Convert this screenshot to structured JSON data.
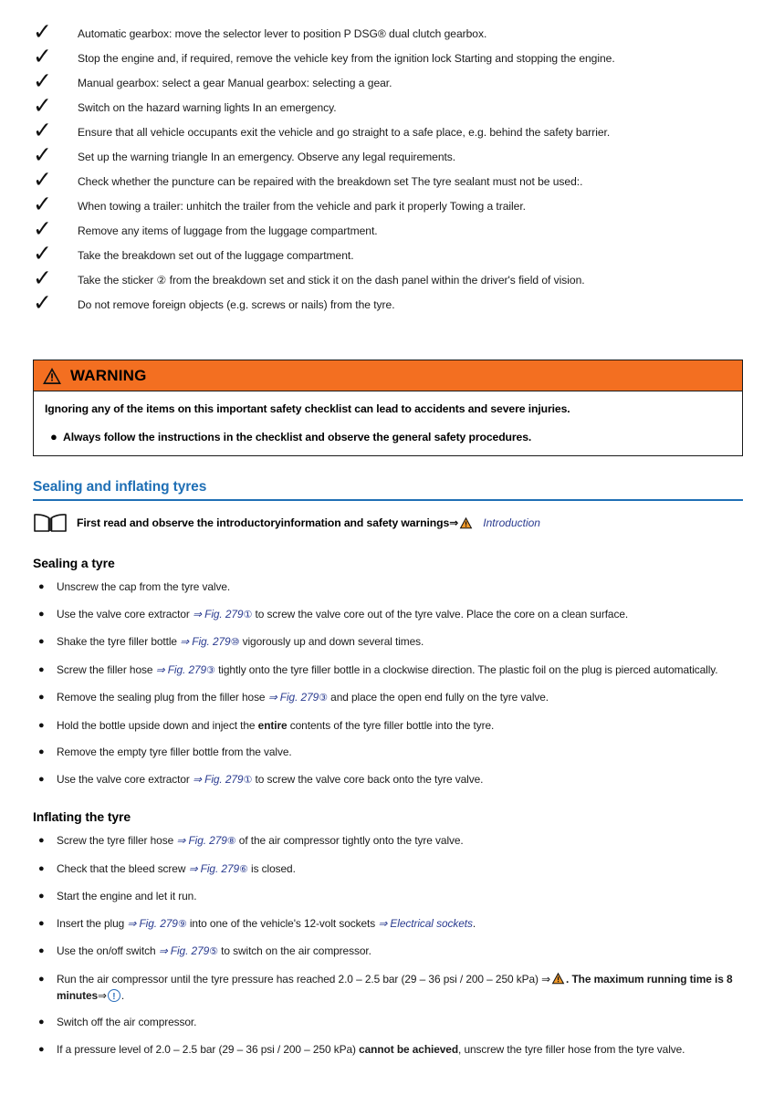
{
  "checklist": {
    "icon": "check-mark-icon",
    "items": [
      "Automatic gearbox: move the selector lever to position P DSG® dual clutch gearbox.",
      "Stop the engine and, if required, remove the vehicle key from the ignition lock Starting and stopping the engine.",
      "Manual gearbox: select a gear Manual gearbox: selecting a gear.",
      "Switch on the hazard warning lights In an emergency.",
      "Ensure that all vehicle occupants exit the vehicle and go straight to a safe place, e.g. behind the safety barrier.",
      "Set up the warning triangle In an emergency. Observe any legal requirements.",
      "Check whether the puncture can be repaired with the breakdown set The tyre sealant must not be used:.",
      "When towing a trailer: unhitch the trailer from the vehicle and park it properly Towing a trailer.",
      "Remove any items of luggage from the luggage compartment.",
      "Take the breakdown set out of the luggage compartment.",
      "Take the sticker ② from the breakdown set and stick it on the dash panel within the driver's field of vision.",
      "Do not remove foreign objects (e.g. screws or nails) from the tyre."
    ]
  },
  "warning": {
    "icon": "warning-triangle-icon",
    "title": "WARNING",
    "header_color": "#F36F21",
    "lead": "Ignoring any of the items on this important safety checklist can lead to accidents and severe injuries.",
    "bullet_marker": "●",
    "bullets": [
      "Always follow the instructions in the checklist and observe the general safety procedures."
    ]
  },
  "section": {
    "title": "Sealing and inflating tyres",
    "accent_color": "#1F6FB5"
  },
  "intro_note": {
    "icon": "open-book-icon",
    "text": "First read and observe the introductoryinformation and safety warnings",
    "arrow": "⇒",
    "warning_icon": "warning-triangle-icon",
    "link": "Introduction"
  },
  "sealing": {
    "heading": "Sealing a tyre",
    "bullet_marker": "●",
    "items": [
      {
        "pre": "Unscrew the cap from the tyre valve.",
        "ref": "",
        "circle": "",
        "post": ""
      },
      {
        "pre": "Use the valve core extractor ",
        "ref": "⇒ Fig. 279",
        "circle": "①",
        "post": " to screw the valve core out of the tyre valve. Place the core on a clean surface."
      },
      {
        "pre": "Shake the tyre filler bottle ",
        "ref": "⇒ Fig. 279",
        "circle": "⑩",
        "post": " vigorously up and down several times."
      },
      {
        "pre": "Screw the filler hose ",
        "ref": "⇒ Fig. 279",
        "circle": "③",
        "post": " tightly onto the tyre filler bottle in a clockwise direction. The plastic foil on the plug is pierced automatically."
      },
      {
        "pre": "Remove the sealing plug from the filler hose ",
        "ref": "⇒ Fig. 279",
        "circle": "③",
        "post": " and place the open end fully on the tyre valve."
      },
      {
        "pre": "Hold the bottle upside down and inject the ",
        "bold": "entire",
        "post": " contents of the tyre filler bottle into the tyre."
      },
      {
        "pre": "Remove the empty tyre filler bottle from the valve.",
        "ref": "",
        "circle": "",
        "post": ""
      },
      {
        "pre": "Use the valve core extractor ",
        "ref": "⇒ Fig. 279",
        "circle": "①",
        "post": " to screw the valve core back onto the tyre valve."
      }
    ]
  },
  "inflating": {
    "heading": "Inflating the tyre",
    "bullet_marker": "●",
    "items": [
      {
        "pre": "Screw the tyre filler hose ",
        "ref": "⇒ Fig. 279",
        "circle": "⑧",
        "post": " of the air compressor tightly onto the tyre valve."
      },
      {
        "pre": "Check that the bleed screw ",
        "ref": "⇒ Fig. 279",
        "circle": "⑥",
        "post": " is closed."
      },
      {
        "pre": "Start the engine and let it run.",
        "ref": "",
        "circle": "",
        "post": ""
      },
      {
        "pre": "Insert the plug ",
        "ref": "⇒ Fig. 279",
        "circle": "⑨",
        "post": " into one of the vehicle's 12-volt sockets ",
        "link": "⇒ Electrical sockets",
        "tail": "."
      },
      {
        "pre": "Use the on/off switch ",
        "ref": "⇒ Fig. 279",
        "circle": "⑤",
        "post": " to switch on the air compressor."
      },
      {
        "pre": "Run the air compressor until the tyre pressure has reached 2.0 – 2.5 bar (29 – 36 psi / 200 – 250 kPa) ",
        "arrow": "⇒",
        "warn_icon": "warning-triangle-icon",
        "bold": ". The maximum running time is 8 minutes",
        "arrow2": "⇒",
        "info_icon": "info-circle-icon",
        "tail": "."
      },
      {
        "pre": "Switch off the air compressor.",
        "ref": "",
        "circle": "",
        "post": ""
      },
      {
        "pre": "If a pressure level of 2.0 – 2.5 bar (29 – 36 psi / 200 – 250 kPa) ",
        "bold": "cannot be achieved",
        "post": ", unscrew the tyre filler hose from the tyre valve."
      }
    ]
  }
}
